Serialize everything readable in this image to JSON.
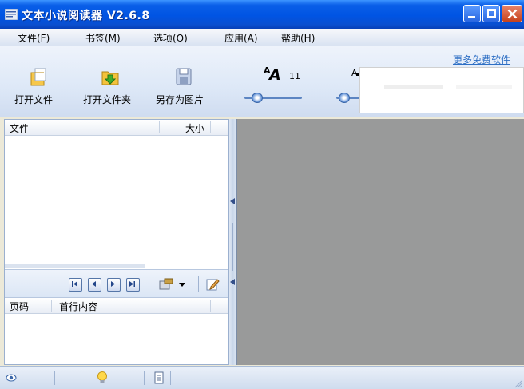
{
  "window": {
    "title": "文本小说阅读器 V2.6.8"
  },
  "menu": {
    "items": [
      {
        "label": "文件(F)"
      },
      {
        "label": "书签(M)"
      },
      {
        "label": "选项(O)"
      },
      {
        "label": "应用(A)"
      },
      {
        "label": "帮助(H)"
      }
    ]
  },
  "toolbar": {
    "open_file": "打开文件",
    "open_folder": "打开文件夹",
    "save_image": "另存为图片",
    "font_size_value": "11",
    "font_size_slider_level": 0.15,
    "line_spacing_slider_level": 0.1,
    "more_link": "更多免费软件"
  },
  "file_list": {
    "headers": {
      "file": "文件",
      "size": "大小"
    }
  },
  "page_list": {
    "headers": {
      "page": "页码",
      "first_line": "首行内容"
    }
  },
  "colors": {
    "titlebar": "#0054e3",
    "reading_bg": "#999a9a",
    "link": "#2e6fc4"
  }
}
